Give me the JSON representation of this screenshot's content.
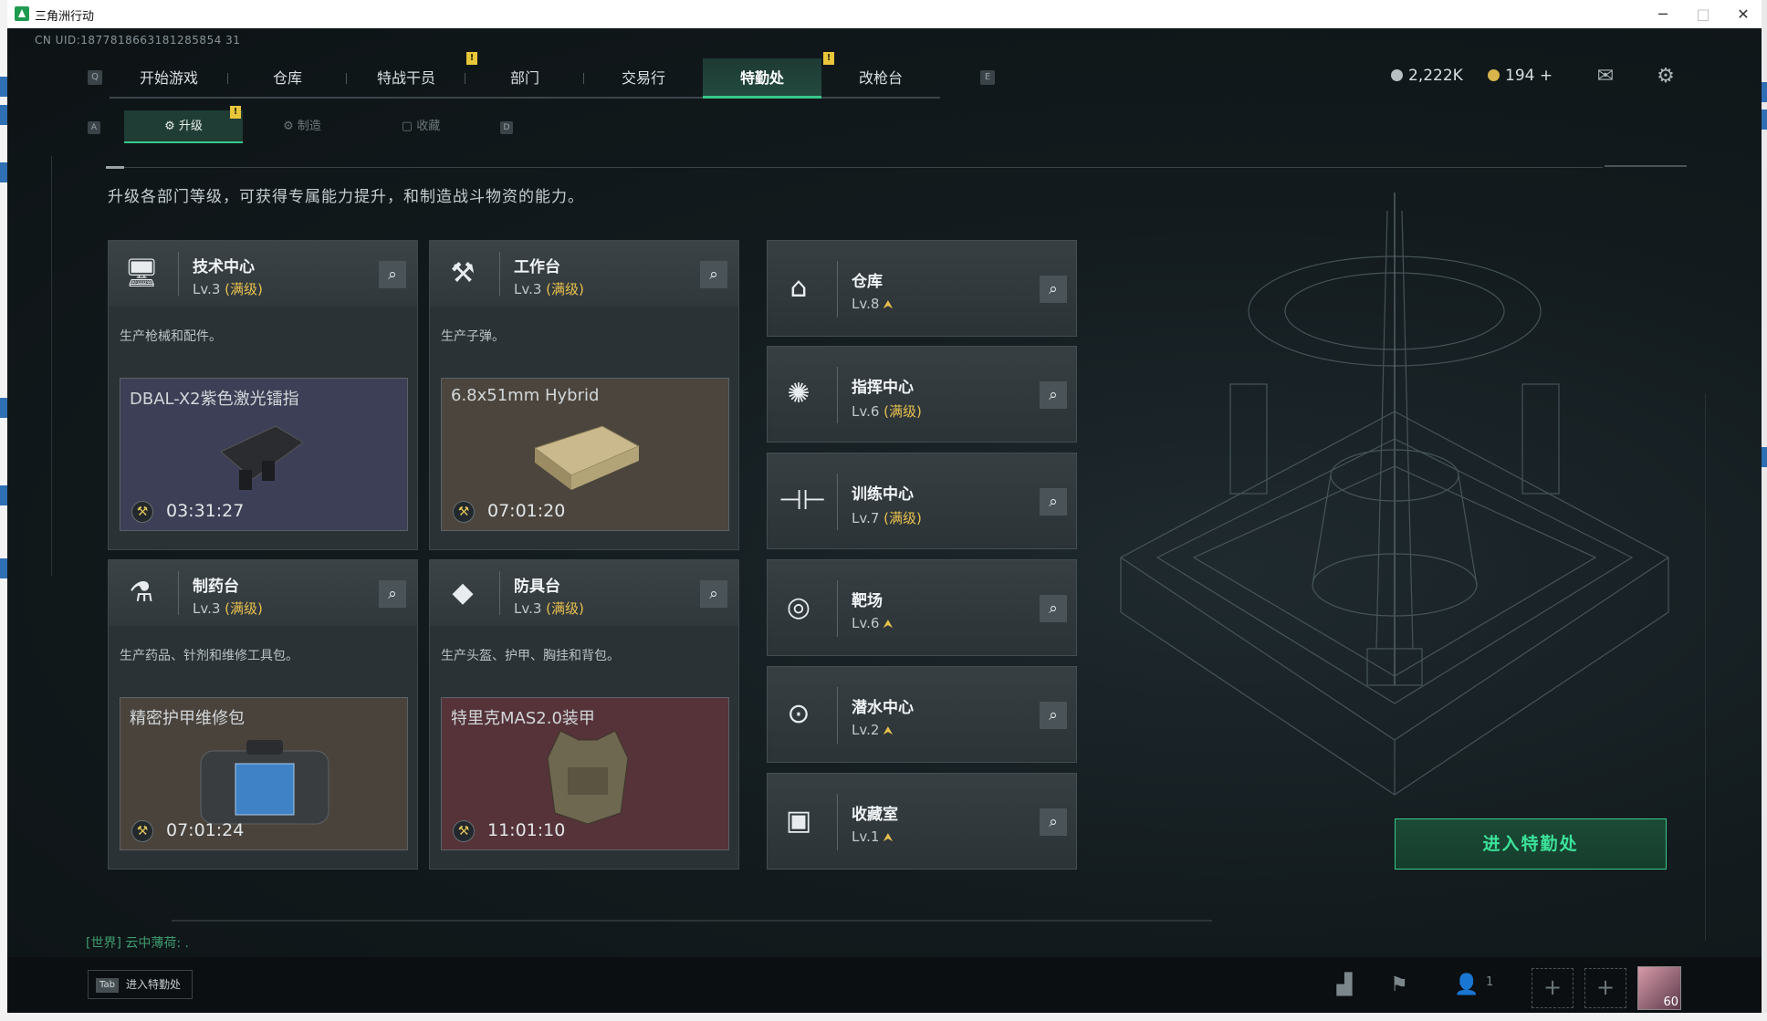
{
  "window": {
    "title": "三角洲行动",
    "minimize": "─",
    "maximize": "□",
    "close": "✕"
  },
  "uid": "CN UID:1877818663181285854 31",
  "nav": {
    "left_key": "Q",
    "right_key": "E",
    "tabs": [
      {
        "label": "开始游戏"
      },
      {
        "label": "仓库"
      },
      {
        "label": "特战干员"
      },
      {
        "label": "部门"
      },
      {
        "label": "交易行"
      },
      {
        "label": "特勤处"
      },
      {
        "label": "改枪台"
      }
    ]
  },
  "alert_mark": "!",
  "currency": {
    "coins": "2,222K",
    "tokens": "194",
    "add": "+"
  },
  "subtabs": {
    "left_key": "A",
    "right_key": "D",
    "items": [
      {
        "label": "升级"
      },
      {
        "label": "制造"
      },
      {
        "label": "收藏"
      }
    ]
  },
  "description": "升级各部门等级，可获得专属能力提升，和制造战斗物资的能力。",
  "max_tag": "(满级)",
  "workshops": [
    {
      "name": "技术中心",
      "level": "Lv.3",
      "desc": "生产枪械和配件。",
      "product": "DBAL-X2紫色激光镭指",
      "time": "03:31:27",
      "bg": "#3c3f55"
    },
    {
      "name": "工作台",
      "level": "Lv.3",
      "desc": "生产子弹。",
      "product": "6.8x51mm Hybrid",
      "time": "07:01:20",
      "bg": "#4b453d"
    },
    {
      "name": "制药台",
      "level": "Lv.3",
      "desc": "生产药品、针剂和维修工具包。",
      "product": "精密护甲维修包",
      "time": "07:01:24",
      "bg": "#4a433c"
    },
    {
      "name": "防具台",
      "level": "Lv.3",
      "desc": "生产头盔、护甲、胸挂和背包。",
      "product": "特里克MAS2.0装甲",
      "time": "11:01:10",
      "bg": "#553339"
    }
  ],
  "facilities": [
    {
      "name": "仓库",
      "level": "Lv.8",
      "max": false
    },
    {
      "name": "指挥中心",
      "level": "Lv.6",
      "max": true
    },
    {
      "name": "训练中心",
      "level": "Lv.7",
      "max": true
    },
    {
      "name": "靶场",
      "level": "Lv.6",
      "max": false
    },
    {
      "name": "潜水中心",
      "level": "Lv.2",
      "max": false
    },
    {
      "name": "收藏室",
      "level": "Lv.1",
      "max": false
    }
  ],
  "enter_button": "进入特勤处",
  "chat": "[世界] 云中薄荷: .",
  "bottom": {
    "tab_key": "Tab",
    "tab_hint": "进入特勤处",
    "friends_count": "1",
    "slot_add": "+",
    "level": "60"
  },
  "colors": {
    "accent": "#38c78b",
    "max_level": "#e8c04d",
    "background": "#131b1e"
  }
}
